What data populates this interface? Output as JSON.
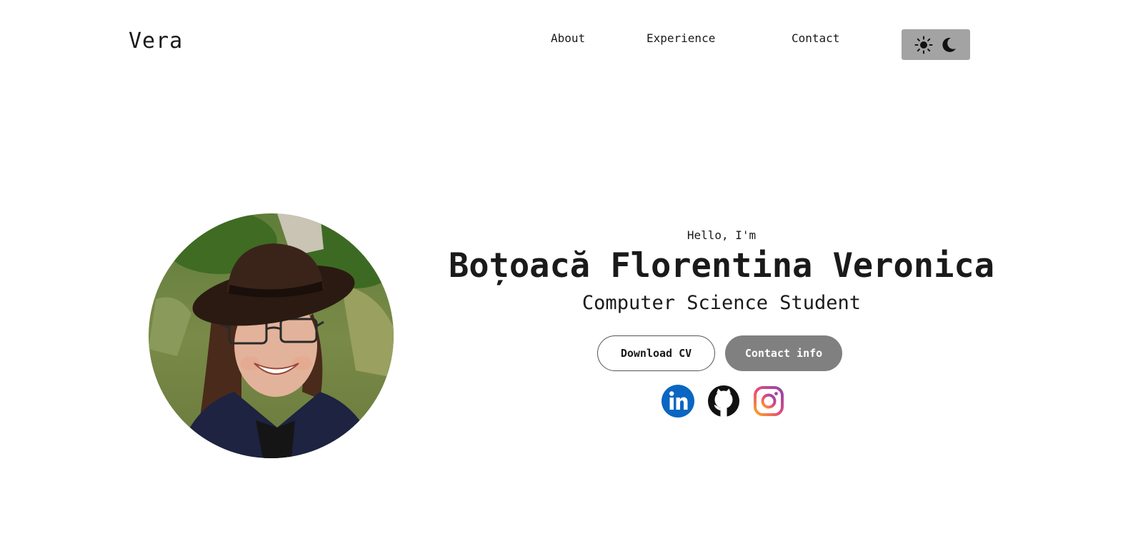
{
  "header": {
    "logo": "Vera",
    "nav": {
      "about": "About",
      "experience": "Experience",
      "contact": "Contact"
    },
    "theme_toggle": {
      "icons": [
        "sun-icon",
        "moon-icon"
      ],
      "background": "#a3a3a3"
    }
  },
  "hero": {
    "greeting": "Hello, I'm",
    "name": "Boțoacă Florentina Veronica",
    "role": "Computer Science Student",
    "buttons": {
      "download_cv": "Download CV",
      "contact_info": "Contact info"
    },
    "socials": [
      "linkedin-icon",
      "github-icon",
      "instagram-icon"
    ]
  },
  "colors": {
    "text": "#1a1a1a",
    "button_filled": "#808080",
    "linkedin": "#0a66c2"
  }
}
